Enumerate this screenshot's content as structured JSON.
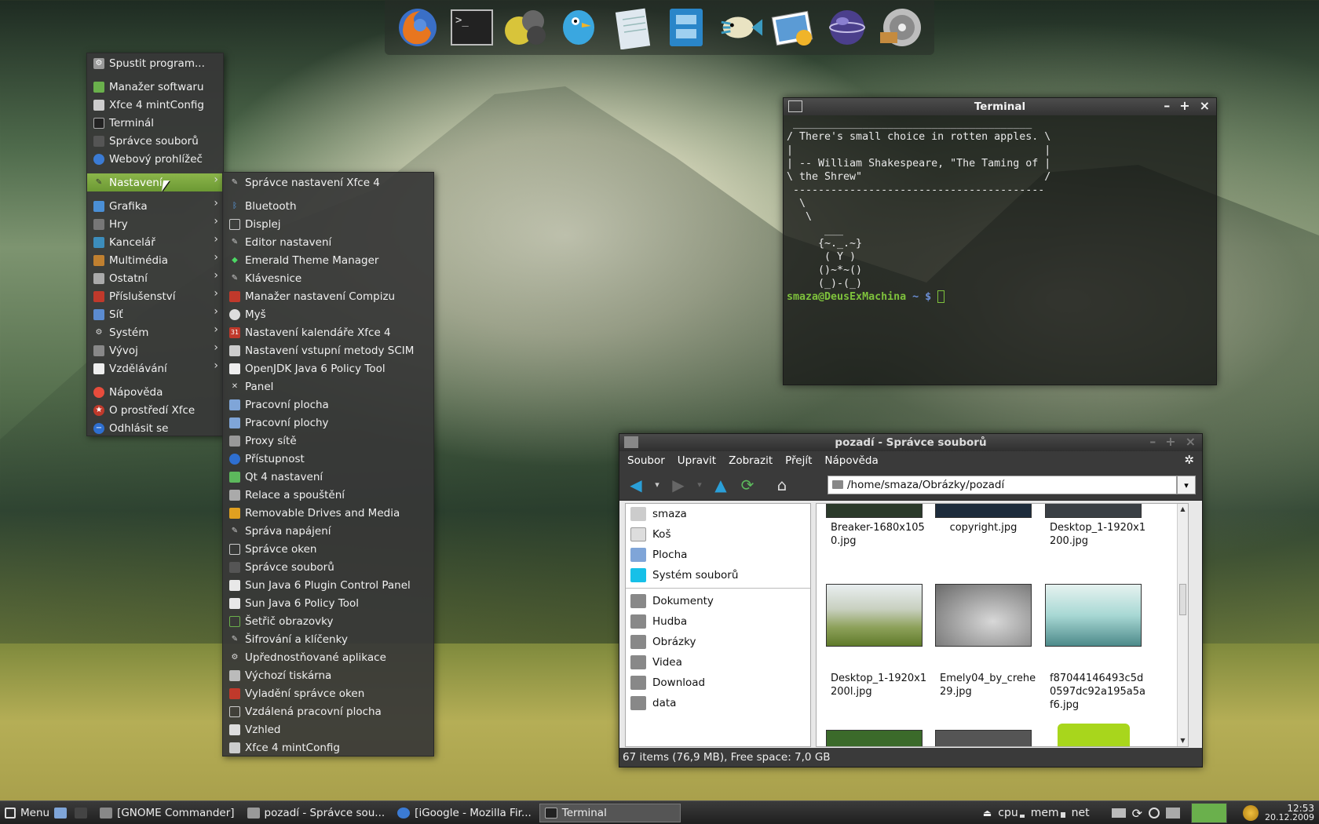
{
  "main_menu": {
    "items": [
      {
        "label": "Spustit program...",
        "icon": "gear-icon"
      },
      {
        "label": "Manažer softwaru",
        "icon": "package-icon"
      },
      {
        "label": "Xfce 4 mintConfig",
        "icon": "config-icon"
      },
      {
        "label": "Terminál",
        "icon": "terminal-icon"
      },
      {
        "label": "Správce souborů",
        "icon": "folder-icon"
      },
      {
        "label": "Webový prohlížeč",
        "icon": "globe-icon"
      },
      {
        "label": "Nastavení",
        "icon": "wrench-icon"
      },
      {
        "label": "Grafika",
        "icon": "image-icon"
      },
      {
        "label": "Hry",
        "icon": "gamepad-icon"
      },
      {
        "label": "Kancelář",
        "icon": "office-icon"
      },
      {
        "label": "Multimédia",
        "icon": "media-icon"
      },
      {
        "label": "Ostatní",
        "icon": "folder-icon"
      },
      {
        "label": "Příslušenství",
        "icon": "accessories-icon"
      },
      {
        "label": "Síť",
        "icon": "network-icon"
      },
      {
        "label": "Systém",
        "icon": "system-icon"
      },
      {
        "label": "Vývoj",
        "icon": "dev-icon"
      },
      {
        "label": "Vzdělávání",
        "icon": "education-icon"
      },
      {
        "label": "Nápověda",
        "icon": "help-icon"
      },
      {
        "label": "O prostředí Xfce",
        "icon": "star-icon"
      },
      {
        "label": "Odhlásit se",
        "icon": "logout-icon"
      }
    ]
  },
  "settings_submenu": {
    "items": [
      "Správce nastavení Xfce 4",
      "Bluetooth",
      "Displej",
      "Editor nastavení",
      "Emerald Theme Manager",
      "Klávesnice",
      "Manažer nastavení Compizu",
      "Myš",
      "Nastavení kalendáře Xfce 4",
      "Nastavení vstupní metody SCIM",
      "OpenJDK Java 6 Policy Tool",
      "Panel",
      "Pracovní plocha",
      "Pracovní plochy",
      "Proxy sítě",
      "Přístupnost",
      "Qt 4 nastavení",
      "Relace a spouštění",
      "Removable Drives and Media",
      "Správa napájení",
      "Správce oken",
      "Správce souborů",
      "Sun Java 6 Plugin Control Panel",
      "Sun Java 6 Policy Tool",
      "Šetřič obrazovky",
      "Šifrování a klíčenky",
      "Upřednostňované aplikace",
      "Výchozí tiskárna",
      "Vyladění správce oken",
      "Vzdálená pracovní plocha",
      "Vzhled",
      "Xfce 4 mintConfig"
    ]
  },
  "terminal": {
    "title": "Terminal",
    "output": " ______________________________________\n/ There's small choice in rotten apples. \\\n|                                        |\n| -- William Shakespeare, \"The Taming of |\n\\ the Shrew\"                             /\n ----------------------------------------\n  \\\n   \\\n      ___\n     {~._.~}\n      ( Y )\n     ()~*~()\n     (_)-(_)",
    "prompt_user": "smaza@DeusExMachina",
    "prompt_path": " ~ $ "
  },
  "file_manager": {
    "title": "pozadí - Správce souborů",
    "menu": [
      "Soubor",
      "Upravit",
      "Zobrazit",
      "Přejít",
      "Nápověda"
    ],
    "path": "/home/smaza/Obrázky/pozadí",
    "places": [
      "smaza",
      "Koš",
      "Plocha",
      "Systém souborů"
    ],
    "bookmarks": [
      "Dokumenty",
      "Hudba",
      "Obrázky",
      "Videa",
      "Download",
      "data"
    ],
    "files": [
      {
        "name": "Breaker-1680x1050.jpg",
        "color": "#2b3a2a"
      },
      {
        "name": "copyright.jpg",
        "color": "#1d2c3c"
      },
      {
        "name": "Desktop_1-1920x1200.jpg",
        "color": "#3a3f44"
      },
      {
        "name": "Desktop_1-1920x1200l.jpg",
        "color": "#8da15a"
      },
      {
        "name": "Emely04_by_crehe29.jpg",
        "color": "#9c9c9c"
      },
      {
        "name": "f87044146493c5d0597dc92a195a5af6.jpg",
        "color": "#8fc7c4"
      }
    ],
    "status": "67 items (76,9 MB), Free space: 7,0 GB"
  },
  "taskbar": {
    "menu_label": "Menu",
    "tasks": [
      "[GNOME Commander]",
      "pozadí - Správce sou...",
      "[iGoogle - Mozilla Fir...",
      "Terminal"
    ],
    "monitors": [
      "cpu",
      "mem",
      "net"
    ],
    "time": "12:53",
    "date": "20.12.2009"
  },
  "dock": {
    "icons": [
      "firefox-icon",
      "terminal-icon",
      "compiz-icon",
      "twitter-bird-icon",
      "notepad-icon",
      "file-cabinet-icon",
      "fish-icon",
      "image-viewer-icon",
      "sphere-icon",
      "media-player-icon"
    ]
  }
}
